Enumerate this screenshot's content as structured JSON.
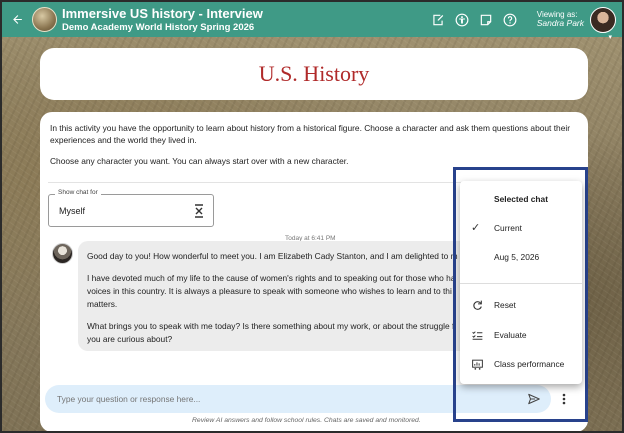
{
  "header": {
    "title": "Immersive US history - Interview",
    "subtitle": "Demo Academy World History Spring 2026",
    "viewing_as_label": "Viewing as:",
    "viewing_as_name": "Sandra Park",
    "icons": [
      "arrow-left-icon",
      "edit-note-icon",
      "accessibility-icon",
      "sticky-note-icon",
      "help-icon"
    ]
  },
  "page_title": "U.S. History",
  "intro": {
    "p1": "In this activity you have the opportunity to learn about history from a historical figure. Choose a character and ask them questions about their experiences and the world they lived in.",
    "p2": "Choose any character you want. You can always start over with a new character."
  },
  "chat_selector": {
    "legend": "Show chat for",
    "value": "Myself"
  },
  "chat": {
    "timestamp": "Today at 6:41 PM",
    "message_lines": [
      "Good day to you! How wonderful to meet you. I am Elizabeth Cady Stanton, and I am delighted to m",
      "I have devoted much of my life to the cause of women's rights and to speaking out for those who ha",
      "voices in this country. It is always a pleasure to speak with someone who wishes to learn and to thi",
      "matters.",
      "What brings you to speak with me today? Is there something about my work, or about the struggle f",
      "you are curious about?"
    ]
  },
  "input": {
    "placeholder": "Type your question or response here..."
  },
  "disclaimer": "Review AI answers and follow school rules. Chats are saved and monitored.",
  "menu": {
    "header": "Selected chat",
    "items": [
      {
        "label": "Current",
        "icon": "check-icon",
        "selected": true
      },
      {
        "label": "Aug 5, 2026",
        "icon": "",
        "selected": false
      },
      {
        "label": "Reset",
        "icon": "reset-icon",
        "selected": false
      },
      {
        "label": "Evaluate",
        "icon": "checklist-icon",
        "selected": false
      },
      {
        "label": "Class performance",
        "icon": "class-performance-icon",
        "selected": false
      }
    ]
  },
  "colors": {
    "header_bg": "#3f9a86",
    "title_red": "#b02a2a",
    "input_bg": "#deeefb",
    "check_accent": "#e3a21a",
    "highlight_border": "#28428c"
  }
}
